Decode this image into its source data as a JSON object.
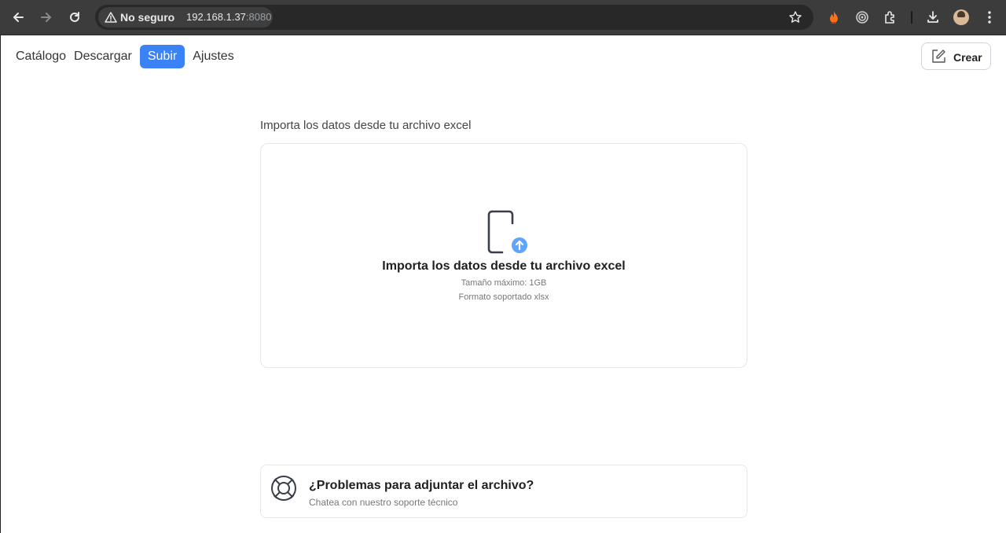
{
  "browser": {
    "security_label": "No seguro",
    "url_host": "192.168.1.37",
    "url_port": ":8080"
  },
  "nav": {
    "items": [
      {
        "label": "Catálogo"
      },
      {
        "label": "Descargar"
      },
      {
        "label": "Subir",
        "active": true
      },
      {
        "label": "Ajustes"
      }
    ],
    "create_label": "Crear"
  },
  "upload": {
    "section_title": "Importa los datos desde tu archivo excel",
    "dropzone_title": "Importa los datos desde tu archivo excel",
    "max_size": "Tamaño máximo: 1GB",
    "format": "Formato soportado xlsx"
  },
  "support": {
    "title": "¿Problemas para adjuntar el archivo?",
    "subtitle": "Chatea con nuestro soporte técnico"
  },
  "colors": {
    "accent": "#3b82f6",
    "upload_badge": "#60a5fa"
  }
}
